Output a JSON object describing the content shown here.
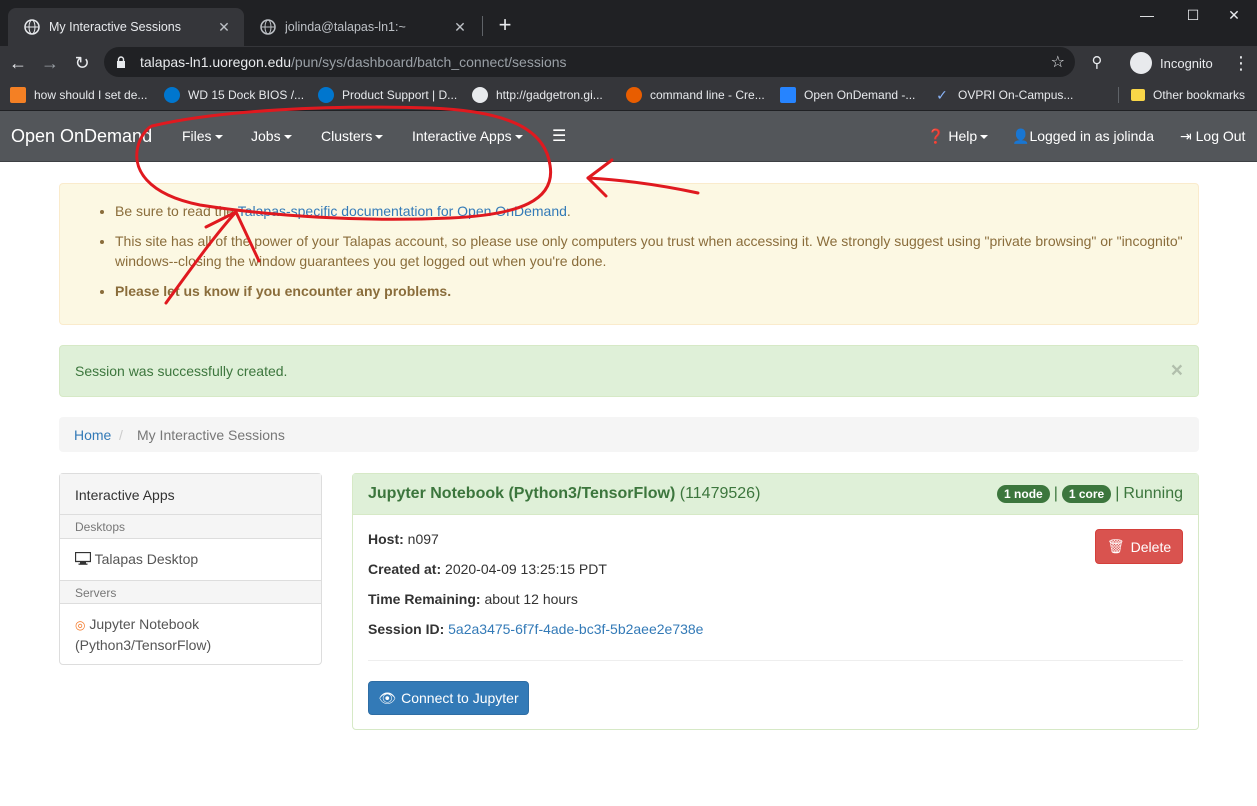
{
  "browser": {
    "tabs": [
      {
        "title": "My Interactive Sessions",
        "close": "✕"
      },
      {
        "title": "jolinda@talapas-ln1:~",
        "close": "✕"
      }
    ],
    "new_tab": "+",
    "window_controls": {
      "minimize": "—",
      "maximize": "☐",
      "close": "✕"
    },
    "url_host": "talapas-ln1.uoregon.edu",
    "url_path": "/pun/sys/dashboard/batch_connect/sessions",
    "incognito_label": "Incognito",
    "bookmarks": [
      {
        "label": "how should I set de...",
        "color": "#f48024"
      },
      {
        "label": "WD 15 Dock BIOS /...",
        "color": "#0076ce"
      },
      {
        "label": "Product Support | D...",
        "color": "#0076ce"
      },
      {
        "label": "http://gadgetron.gi...",
        "color": "#e8eaed"
      },
      {
        "label": "command line - Cre...",
        "color": "#e85d00"
      },
      {
        "label": "Open OnDemand -...",
        "color": "#2684ff"
      },
      {
        "label": "OVPRI On-Campus...",
        "color": "#1a73e8"
      }
    ],
    "other_bookmarks": "Other bookmarks"
  },
  "navbar": {
    "brand": "Open OnDemand",
    "menus": [
      "Files",
      "Jobs",
      "Clusters",
      "Interactive Apps"
    ],
    "help": "Help",
    "logged_in": "Logged in as jolinda",
    "logout": "Log Out"
  },
  "notice": {
    "item1_prefix": "Be sure to read the ",
    "item1_link": "Talapas-specific documentation for Open OnDemand",
    "item1_suffix": ".",
    "item2": "This site has all of the power of your Talapas account, so please use only computers you trust when accessing it. We strongly suggest using \"private browsing\" or \"incognito\" windows--closing the window guarantees you get logged out when you're done.",
    "item3": "Please let us know if you encounter any problems."
  },
  "success": {
    "message": "Session was successfully created.",
    "close": "×"
  },
  "breadcrumb": {
    "home": "Home",
    "separator": "/",
    "current": "My Interactive Sessions"
  },
  "sidebar": {
    "title": "Interactive Apps",
    "cat_desktops": "Desktops",
    "desktop_item": "Talapas Desktop",
    "cat_servers": "Servers",
    "server_item_line1": "Jupyter Notebook",
    "server_item_line2": "(Python3/TensorFlow)"
  },
  "session": {
    "name": "Jupyter Notebook (Python3/TensorFlow)",
    "job_id": "(11479526)",
    "nodes_badge": "1 node",
    "cores_badge": "1 core",
    "divider": "|",
    "status": "Running",
    "host_label": "Host:",
    "host": "n097",
    "created_label": "Created at:",
    "created": "2020-04-09 13:25:15 PDT",
    "remaining_label": "Time Remaining:",
    "remaining": "about 12 hours",
    "id_label": "Session ID:",
    "session_id": "5a2a3475-6f7f-4ade-bc3f-5b2aee2e738e",
    "delete_label": "Delete",
    "connect_label": "Connect to Jupyter"
  },
  "colors": {
    "navbar": "#53565a",
    "success": "#3c763d",
    "danger": "#d9534f",
    "primary": "#337ab7",
    "annotation": "#e0191f"
  }
}
